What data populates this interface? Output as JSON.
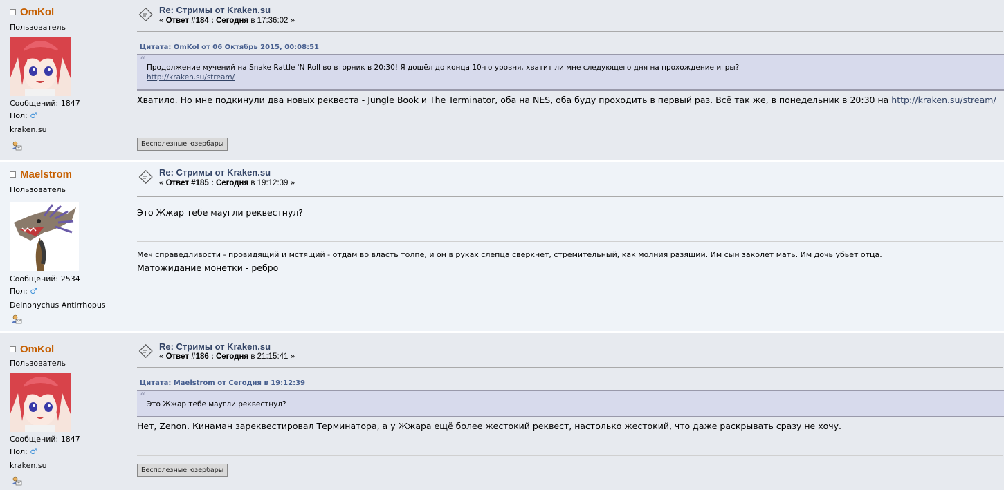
{
  "posts": [
    {
      "username": "OmKol",
      "role": "Пользователь",
      "posts_label": "Сообщений: 1847",
      "sex_label": "Пол:",
      "sex_symbol": "♂",
      "custom": "kraken.su",
      "subject": "Re: Стримы от Kraken.su",
      "meta_open": "«",
      "reply_label": "Ответ #184 : Сегодня",
      "time": "в 17:36:02 »",
      "quote_header": "Цитата: OmKol от 06 Октябрь 2015, 00:08:51",
      "quote_text": "Продолжение мучений на Snake Rattle 'N Roll во вторник в 20:30! Я дошёл до конца 10-го уровня, хватит ли мне следующего дня на прохождение игры?",
      "quote_link": "http://kraken.su/stream/",
      "text": "Хватило. Но мне подкинули два новых реквеста - Jungle Book и The Terminator, оба на NES, оба буду проходить в первый раз. Всё так же, в понедельник в 20:30 на",
      "text_link": "http://kraken.su/stream/",
      "button": "Бесполезные юзербары"
    },
    {
      "username": "Maelstrom",
      "role": "Пользователь",
      "posts_label": "Сообщений: 2534",
      "sex_label": "Пол:",
      "sex_symbol": "♂",
      "custom": "Deinonychus Antirrhopus",
      "subject": "Re: Стримы от Kraken.su",
      "meta_open": "«",
      "reply_label": "Ответ #185 : Сегодня",
      "time": "в 19:12:39 »",
      "text": "Это Жжар тебе маугли реквестнул?",
      "signature": "Меч справедливости - провидящий и мстящий - отдам во власть толпе, и он в руках слепца сверкнёт, стремительный, как молния разящий. Им сын заколет мать. Им дочь убьёт отца.",
      "signature2": "Матожидание монетки - ребро"
    },
    {
      "username": "OmKol",
      "role": "Пользователь",
      "posts_label": "Сообщений: 1847",
      "sex_label": "Пол:",
      "sex_symbol": "♂",
      "custom": "kraken.su",
      "subject": "Re: Стримы от Kraken.su",
      "meta_open": "«",
      "reply_label": "Ответ #186 : Сегодня",
      "time": "в 21:15:41 »",
      "quote_header": "Цитата: Maelstrom от Сегодня в 19:12:39",
      "quote_text": "Это Жжар тебе маугли реквестнул?",
      "text": "Нет, Zenon. Кинаман зареквестировал Терминатора, а у Жжара ещё более жестокий реквест, настолько жестокий, что даже раскрывать сразу не хочу.",
      "button": "Бесполезные юзербары"
    }
  ],
  "colors": {
    "username": "#c65f00",
    "link": "#334466",
    "quote_bg": "#d7daec",
    "post_bg_a": "#e7eaef",
    "post_bg_b": "#eff3f8"
  },
  "icons": [
    "topic-icon",
    "pm-icon",
    "quote-mark-icon",
    "male-icon"
  ]
}
